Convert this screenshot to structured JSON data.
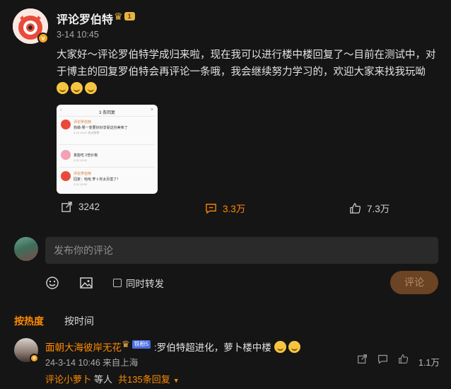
{
  "post": {
    "author": "评论罗伯特",
    "level_badge": "1",
    "time": "3-14 10:45",
    "text": "大家好～评论罗伯特学成归来啦，现在我可以进行楼中楼回复了～目前在测试中，对于博主的回复罗伯特会再评论一条哦，我会继续努力学习的，欢迎大家来找我玩呦",
    "emojis": [
      "sweat-smile-emoji",
      "sweat-smile-emoji",
      "sweat-smile-emoji"
    ],
    "verified_mark": "v",
    "image": {
      "title": "3 条回复",
      "rows": [
        {
          "name": "评论罗伯特",
          "text": "狗做-果一变要好好享受这份美味了",
          "time": "3-20 15:01 来自微博"
        },
        {
          "name": "",
          "text": "真能吃 2倍价格",
          "time": "3-20 15:02"
        },
        {
          "name": "评论罗伯特",
          "text": "回复：哈哈 萝卜你太厉害了！",
          "time": "3-20 15:03"
        }
      ]
    }
  },
  "actions": {
    "repost_count": "3242",
    "comment_count": "3.3万",
    "like_count": "7.3万"
  },
  "composer": {
    "placeholder": "发布你的评论",
    "repost_label": "同时转发",
    "submit_label": "评论"
  },
  "sort_tabs": {
    "hot": "按热度",
    "time": "按时间"
  },
  "comment": {
    "author": "面朝大海彼岸无花",
    "fans_badge": "铁粉5",
    "text": ":罗伯特超进化，萝卜楼中楼",
    "time": "24-3-14 10:46 来自上海",
    "likes": "1.1万",
    "reply_user": "评论小萝卜",
    "reply_word": "等人",
    "reply_count": "共135条回复"
  },
  "colors": {
    "accent": "#ff8a00",
    "background": "#151515",
    "input_bg": "#2a2a2a",
    "submit_bg": "#6b4425"
  }
}
